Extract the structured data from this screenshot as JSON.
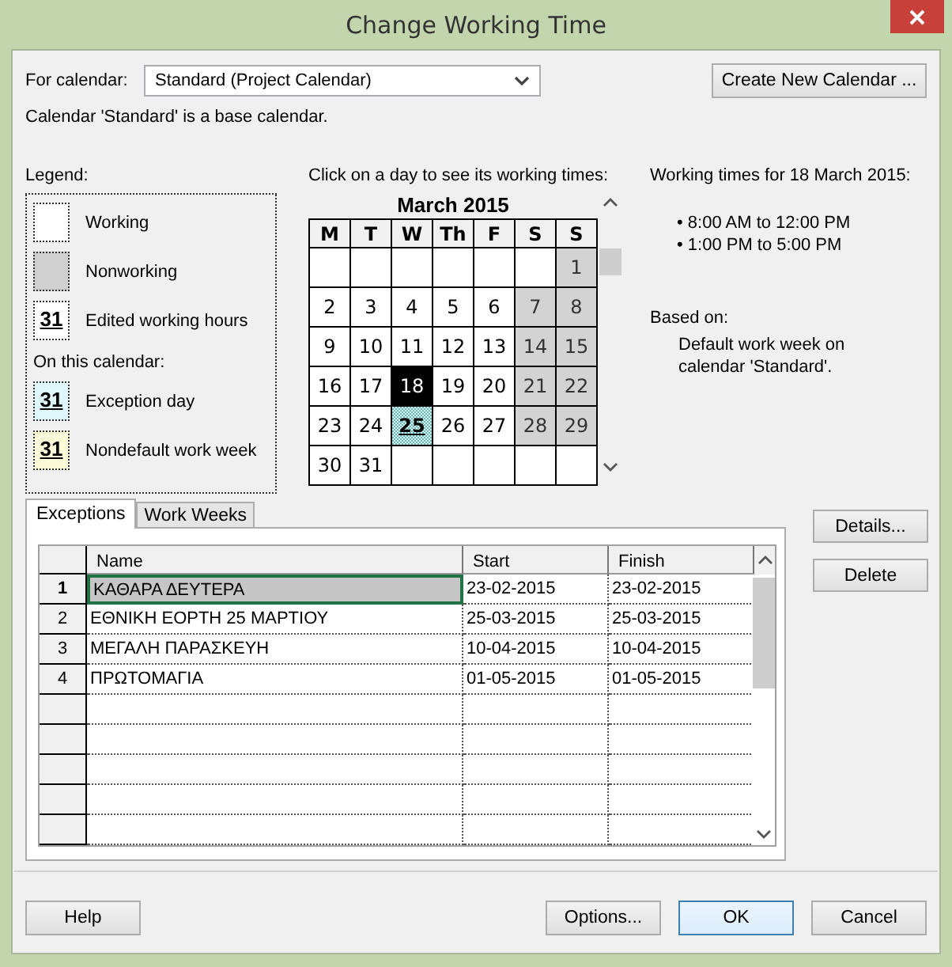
{
  "window": {
    "title": "Change Working Time"
  },
  "calendar_select": {
    "label": "For calendar:",
    "value": "Standard (Project Calendar)"
  },
  "create_button": "Create New Calendar ...",
  "info": "Calendar 'Standard' is a base calendar.",
  "legend": {
    "title": "Legend:",
    "items": [
      {
        "kind": "working",
        "label": "Working"
      },
      {
        "kind": "nonworking",
        "label": "Nonworking"
      },
      {
        "kind": "edited",
        "sample": "31",
        "label": "Edited working hours"
      }
    ],
    "subtitle": "On this calendar:",
    "calendar_items": [
      {
        "kind": "exception",
        "sample": "31",
        "label": "Exception day"
      },
      {
        "kind": "nondefault",
        "sample": "31",
        "label": "Nondefault work week"
      }
    ]
  },
  "month": {
    "instruction": "Click on a day to see its working times:",
    "title": "March 2015",
    "weekdays": [
      "M",
      "T",
      "W",
      "Th",
      "F",
      "S",
      "S"
    ],
    "weeks": [
      [
        {
          "kind": "blank"
        },
        {
          "kind": "blank"
        },
        {
          "kind": "blank"
        },
        {
          "kind": "blank"
        },
        {
          "kind": "blank"
        },
        {
          "kind": "blank"
        },
        {
          "kind": "nonworking",
          "day": "1"
        }
      ],
      [
        {
          "kind": "working",
          "day": "2"
        },
        {
          "kind": "working",
          "day": "3"
        },
        {
          "kind": "working",
          "day": "4"
        },
        {
          "kind": "working",
          "day": "5"
        },
        {
          "kind": "working",
          "day": "6"
        },
        {
          "kind": "nonworking",
          "day": "7"
        },
        {
          "kind": "nonworking",
          "day": "8"
        }
      ],
      [
        {
          "kind": "working",
          "day": "9"
        },
        {
          "kind": "working",
          "day": "10"
        },
        {
          "kind": "working",
          "day": "11"
        },
        {
          "kind": "working",
          "day": "12"
        },
        {
          "kind": "working",
          "day": "13"
        },
        {
          "kind": "nonworking",
          "day": "14"
        },
        {
          "kind": "nonworking",
          "day": "15"
        }
      ],
      [
        {
          "kind": "working",
          "day": "16"
        },
        {
          "kind": "working",
          "day": "17"
        },
        {
          "kind": "selected",
          "day": "18"
        },
        {
          "kind": "working",
          "day": "19"
        },
        {
          "kind": "working",
          "day": "20"
        },
        {
          "kind": "nonworking",
          "day": "21"
        },
        {
          "kind": "nonworking",
          "day": "22"
        }
      ],
      [
        {
          "kind": "working",
          "day": "23"
        },
        {
          "kind": "working",
          "day": "24"
        },
        {
          "kind": "exception",
          "day": "25"
        },
        {
          "kind": "working",
          "day": "26"
        },
        {
          "kind": "working",
          "day": "27"
        },
        {
          "kind": "nonworking",
          "day": "28"
        },
        {
          "kind": "nonworking",
          "day": "29"
        }
      ],
      [
        {
          "kind": "working",
          "day": "30"
        },
        {
          "kind": "working",
          "day": "31"
        },
        {
          "kind": "blank"
        },
        {
          "kind": "blank"
        },
        {
          "kind": "blank"
        },
        {
          "kind": "blank"
        },
        {
          "kind": "blank"
        }
      ]
    ]
  },
  "details": {
    "heading": "Working times for 18 March 2015:",
    "times": [
      "• 8:00 AM to 12:00 PM",
      "• 1:00 PM to 5:00 PM"
    ],
    "based_on_label": "Based on:",
    "based_on": "Default work week on calendar 'Standard'."
  },
  "tabs": [
    {
      "label": "Exceptions",
      "selected": true
    },
    {
      "label": "Work Weeks",
      "selected": false
    }
  ],
  "table": {
    "columns": [
      "Name",
      "Start",
      "Finish"
    ],
    "rows": [
      {
        "number": "1",
        "name": "ΚΑΘΑΡΑ ΔΕΥΤΕΡΑ",
        "start": "23-02-2015",
        "finish": "23-02-2015",
        "selected": true
      },
      {
        "number": "2",
        "name": "ΕΘΝΙΚΗ ΕΟΡΤΗ 25 ΜΑΡΤΙΟΥ",
        "start": "25-03-2015",
        "finish": "25-03-2015",
        "selected": false
      },
      {
        "number": "3",
        "name": "ΜΕΓΑΛΗ ΠΑΡΑΣΚΕΥΗ",
        "start": "10-04-2015",
        "finish": "10-04-2015",
        "selected": false
      },
      {
        "number": "4",
        "name": "ΠΡΩΤΟΜΑΓΙΑ",
        "start": "01-05-2015",
        "finish": "01-05-2015",
        "selected": false
      }
    ]
  },
  "side_buttons": [
    "Details...",
    "Delete"
  ],
  "footer_buttons": [
    {
      "label": "Help",
      "default": false
    },
    {
      "label": "Options...",
      "default": false
    },
    {
      "label": "OK",
      "default": true
    },
    {
      "label": "Cancel",
      "default": false
    }
  ]
}
